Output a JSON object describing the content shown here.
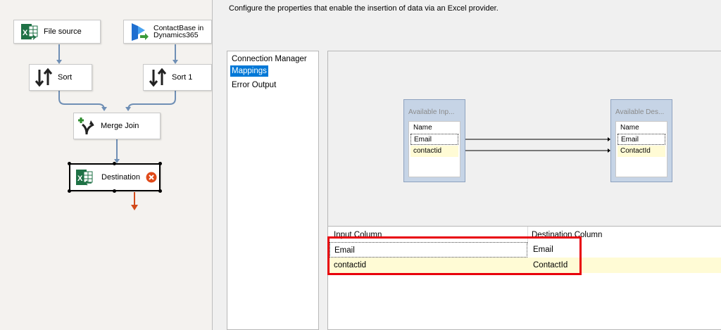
{
  "flow": {
    "nodes": {
      "file_source": "File source",
      "contactbase_line1": "ContactBase in",
      "contactbase_line2": "Dynamics365",
      "sort": "Sort",
      "sort1": "Sort 1",
      "merge_join": "Merge Join",
      "destination": "Destination"
    }
  },
  "dialog": {
    "description": "Configure the properties that enable the insertion of data via an Excel provider.",
    "nav": [
      "Connection Manager",
      "Mappings",
      "Error Output"
    ],
    "selected_nav": "Mappings",
    "available_input": {
      "title": "Available Inp...",
      "header": "Name",
      "columns": [
        "Email",
        "contactid"
      ]
    },
    "available_destination": {
      "title": "Available Des...",
      "header": "Name",
      "columns": [
        "Email",
        "ContactId"
      ]
    },
    "grid": {
      "headers": [
        "Input Column",
        "Destination Column"
      ],
      "rows": [
        {
          "input": "Email",
          "destination": "Email"
        },
        {
          "input": "contactid",
          "destination": "ContactId"
        }
      ]
    }
  },
  "colors": {
    "highlight": "#e8000b",
    "selection": "#0078d7",
    "error_badge": "#e04a1a"
  }
}
